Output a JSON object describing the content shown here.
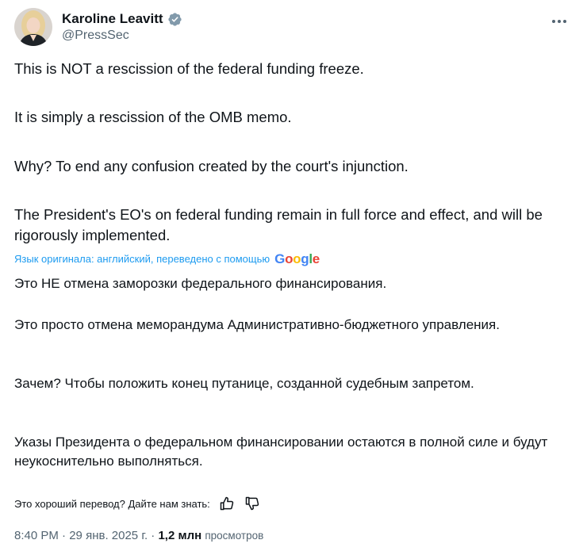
{
  "author": {
    "name": "Karoline Leavitt",
    "handle": "@PressSec"
  },
  "original": [
    "This is NOT a rescission of the federal funding freeze.",
    "It is simply a rescission of the OMB memo.",
    "Why? To end any confusion created by the court's injunction.",
    "The President's EO's on federal funding remain in full force and effect, and will be rigorously implemented."
  ],
  "translation_note": "Язык оригинала: английский, переведено с помощью",
  "translation_provider": "Google",
  "translated": [
    "Это НЕ отмена заморозки федерального финансирования.",
    "Это просто отмена меморандума Административно-бюджетного управления.",
    "Зачем? Чтобы положить конец путанице, созданной судебным запретом.",
    "Указы Президента о федеральном финансировании остаются в полной силе и будут неукоснительно выполняться."
  ],
  "feedback": {
    "prompt": "Это хороший перевод? Дайте нам знать:",
    "icons": [
      "thumbs-up-icon",
      "thumbs-down-icon"
    ]
  },
  "meta": {
    "time": "8:40 PM",
    "date": "29 янв. 2025 г.",
    "views_count": "1,2 млн",
    "views_label": "просмотров"
  },
  "colors": {
    "text": "#0f1419",
    "secondary": "#536471",
    "accent": "#1d9bf0",
    "verified_badge": "#829aab"
  }
}
